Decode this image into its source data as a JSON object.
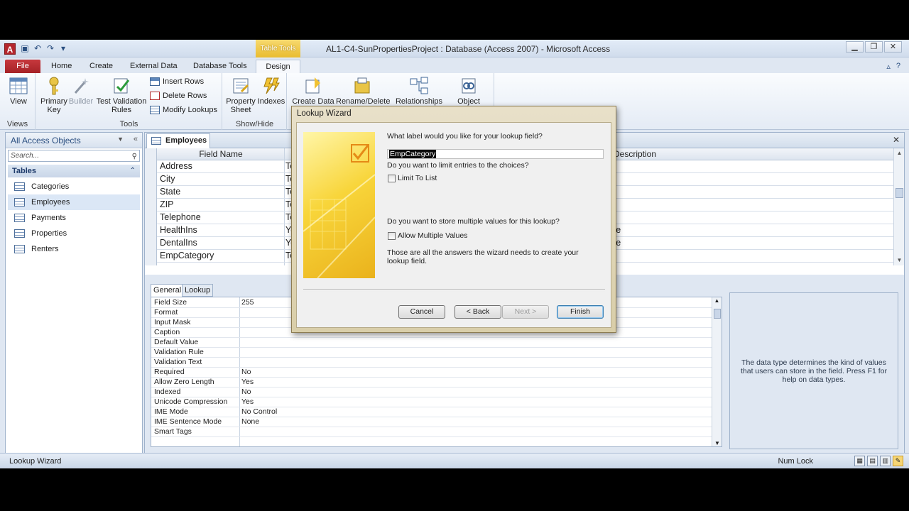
{
  "window": {
    "title": "AL1-C4-SunPropertiesProject : Database (Access 2007)  -  Microsoft Access",
    "app_icon": "A",
    "context_tab": "Table Tools"
  },
  "ribbon_tabs": [
    "File",
    "Home",
    "Create",
    "External Data",
    "Database Tools",
    "Design"
  ],
  "ribbon": {
    "views": {
      "view": "View",
      "group": "Views"
    },
    "tools": {
      "primary_key": "Primary Key",
      "builder": "Builder",
      "test_validation": "Test Validation Rules",
      "insert_rows": "Insert Rows",
      "delete_rows": "Delete Rows",
      "modify_lookups": "Modify Lookups",
      "group": "Tools"
    },
    "showhide": {
      "property_sheet": "Property Sheet",
      "indexes": "Indexes",
      "group": "Show/Hide"
    },
    "events": {
      "create_data": "Create Data",
      "rename_delete": "Rename/Delete"
    },
    "relationships": {
      "relationships": "Relationships",
      "object": "Object"
    }
  },
  "nav": {
    "header": "All Access Objects",
    "search_placeholder": "Search...",
    "group": "Tables",
    "items": [
      "Categories",
      "Employees",
      "Payments",
      "Properties",
      "Renters"
    ]
  },
  "doc": {
    "tab": "Employees",
    "columns": {
      "field_name": "Field Name",
      "description": "Description"
    },
    "rows": [
      {
        "name": "Address",
        "type": "Te",
        "desc": ""
      },
      {
        "name": "City",
        "type": "Te",
        "desc": ""
      },
      {
        "name": "State",
        "type": "Te",
        "desc": ""
      },
      {
        "name": "ZIP",
        "type": "Te",
        "desc": ""
      },
      {
        "name": "Telephone",
        "type": "Te",
        "desc": ""
      },
      {
        "name": "HealthIns",
        "type": "Ye",
        "desc": "ce"
      },
      {
        "name": "DentalIns",
        "type": "Ye",
        "desc": "ce"
      },
      {
        "name": "EmpCategory",
        "type": "Te",
        "desc": ""
      }
    ]
  },
  "props": {
    "tabs": [
      "General",
      "Lookup"
    ],
    "rows": [
      {
        "name": "Field Size",
        "value": "255"
      },
      {
        "name": "Format",
        "value": ""
      },
      {
        "name": "Input Mask",
        "value": ""
      },
      {
        "name": "Caption",
        "value": ""
      },
      {
        "name": "Default Value",
        "value": ""
      },
      {
        "name": "Validation Rule",
        "value": ""
      },
      {
        "name": "Validation Text",
        "value": ""
      },
      {
        "name": "Required",
        "value": "No"
      },
      {
        "name": "Allow Zero Length",
        "value": "Yes"
      },
      {
        "name": "Indexed",
        "value": "No"
      },
      {
        "name": "Unicode Compression",
        "value": "Yes"
      },
      {
        "name": "IME Mode",
        "value": "No Control"
      },
      {
        "name": "IME Sentence Mode",
        "value": "None"
      },
      {
        "name": "Smart Tags",
        "value": ""
      }
    ],
    "help": "The data type determines the kind of values that users can store in the field. Press F1 for help on data types."
  },
  "wizard": {
    "title": "Lookup Wizard",
    "q_label": "What label would you like for your lookup field?",
    "label_value": "EmpCategory",
    "q_limit": "Do you want to limit entries to the choices?",
    "limit_cb": "Limit To List",
    "q_multi": "Do you want to store multiple values for this lookup?",
    "multi_cb": "Allow Multiple Values",
    "note": "Those are all the answers the wizard needs to create your lookup field.",
    "buttons": {
      "cancel": "Cancel",
      "back": "< Back",
      "next": "Next >",
      "finish": "Finish"
    }
  },
  "status": {
    "left": "Lookup Wizard",
    "right": "Num Lock"
  }
}
